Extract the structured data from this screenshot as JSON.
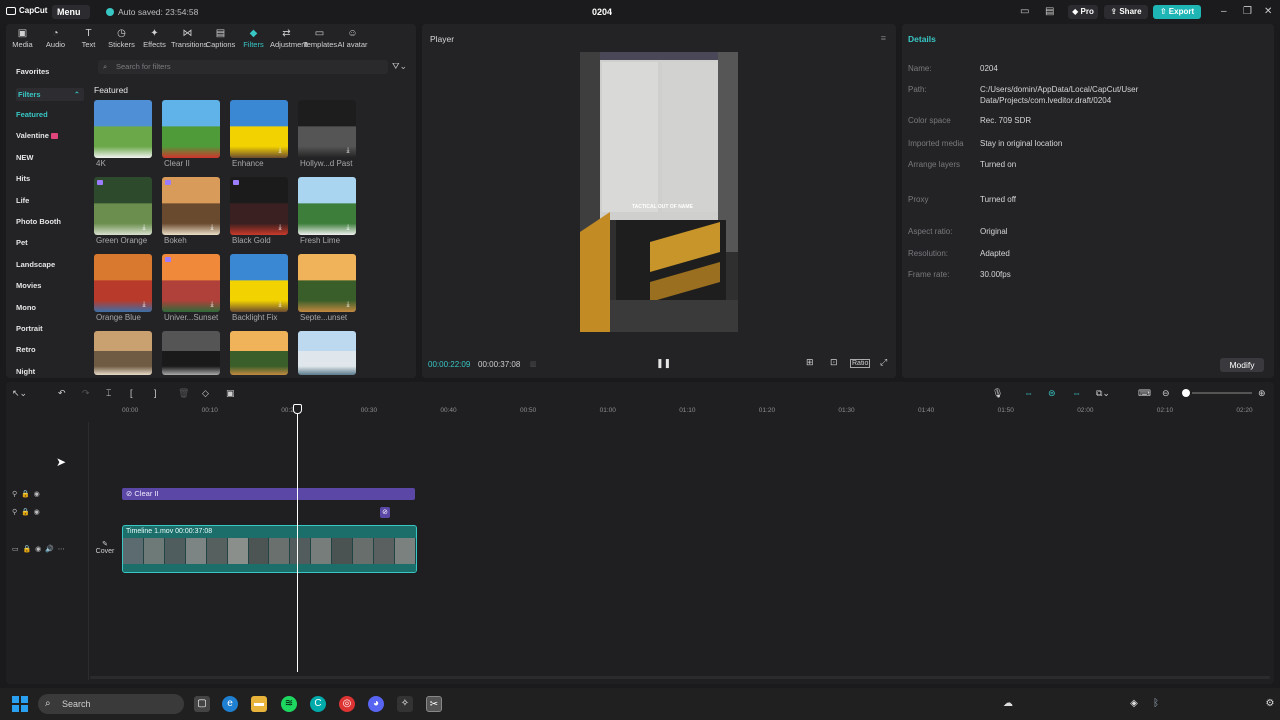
{
  "topbar": {
    "app_name": "CapCut",
    "menu_label": "Menu",
    "autosave_text": "Auto saved: 23:54:58",
    "project_title": "0204",
    "pro_label": "Pro",
    "share_label": "Share",
    "export_label": "Export"
  },
  "tools": [
    {
      "label": "Media",
      "icon": "media-icon"
    },
    {
      "label": "Audio",
      "icon": "audio-icon"
    },
    {
      "label": "Text",
      "icon": "text-icon"
    },
    {
      "label": "Stickers",
      "icon": "stickers-icon"
    },
    {
      "label": "Effects",
      "icon": "effects-icon"
    },
    {
      "label": "Transitions",
      "icon": "transitions-icon"
    },
    {
      "label": "Captions",
      "icon": "captions-icon"
    },
    {
      "label": "Filters",
      "icon": "filters-icon"
    },
    {
      "label": "Adjustment",
      "icon": "adjustment-icon"
    },
    {
      "label": "Templates",
      "icon": "templates-icon"
    },
    {
      "label": "AI avatar",
      "icon": "ai-avatar-icon"
    }
  ],
  "active_tool": "Filters",
  "sidebar": {
    "favorites": "Favorites",
    "filters": "Filters",
    "categories": [
      "Featured",
      "Valentine",
      "NEW",
      "Hits",
      "Life",
      "Photo Booth",
      "Pet",
      "Landscape",
      "Movies",
      "Mono",
      "Portrait",
      "Retro",
      "Night"
    ]
  },
  "search": {
    "placeholder": "Search for filters"
  },
  "featured": {
    "section_title": "Featured",
    "items": [
      {
        "label": "4K"
      },
      {
        "label": "Clear II"
      },
      {
        "label": "Enhance"
      },
      {
        "label": "Hollyw...d Past"
      },
      {
        "label": "Green Orange"
      },
      {
        "label": "Bokeh"
      },
      {
        "label": "Black Gold"
      },
      {
        "label": "Fresh Lime"
      },
      {
        "label": "Orange Blue"
      },
      {
        "label": "Univer...Sunset"
      },
      {
        "label": "Backlight Fix"
      },
      {
        "label": "Septe...unset"
      }
    ]
  },
  "player": {
    "title": "Player",
    "current_time": "00:00:22:09",
    "total_time": "00:00:37:08",
    "overlay_text": "TACTICAL OUT OF NAME",
    "ratio_label": "Ratio"
  },
  "details": {
    "title": "Details",
    "rows": [
      {
        "label": "Name:",
        "value": "0204"
      },
      {
        "label": "Path:",
        "value": "C:/Users/domin/AppData/Local/CapCut/User Data/Projects/com.lveditor.draft/0204"
      },
      {
        "label": "Color space",
        "value": "Rec. 709 SDR"
      },
      {
        "label": "Imported media",
        "value": "Stay in original location"
      },
      {
        "label": "Arrange layers",
        "value": "Turned on"
      },
      {
        "label": "Proxy",
        "value": "Turned off"
      },
      {
        "label": "Aspect ratio:",
        "value": "Original"
      },
      {
        "label": "Resolution:",
        "value": "Adapted"
      },
      {
        "label": "Frame rate:",
        "value": "30.00fps"
      }
    ],
    "modify_label": "Modify"
  },
  "timeline": {
    "ruler": [
      "00:00",
      "00:10",
      "00:20",
      "00:30",
      "00:40",
      "00:50",
      "01:00",
      "01:10",
      "01:20",
      "01:30",
      "01:40",
      "01:50",
      "02:00",
      "02:10",
      "02:20"
    ],
    "filter_clip_label": "Clear II",
    "main_clip_label": "Timeline 1.mov  00:00:37:08",
    "cover_label": "Cover"
  },
  "taskbar": {
    "search_label": "Search"
  },
  "colors": {
    "accent": "#38c7c4",
    "filter_clip": "#5a47a6",
    "main_clip": "#1b6e6a"
  }
}
